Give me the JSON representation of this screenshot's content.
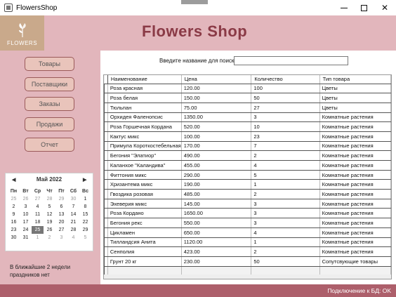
{
  "window": {
    "title": "FlowersShop"
  },
  "logo": {
    "text": "FLOWERS"
  },
  "header": {
    "title": "Flowers Shop"
  },
  "nav": [
    "Товары",
    "Поставщики",
    "Заказы",
    "Продажи",
    "Отчет"
  ],
  "calendar": {
    "month": "Май 2022",
    "weekdays": [
      "Пн",
      "Вт",
      "Ср",
      "Чт",
      "Пт",
      "Сб",
      "Вс"
    ],
    "days": [
      [
        "25",
        "26",
        "27",
        "28",
        "29",
        "30",
        "1"
      ],
      [
        "2",
        "3",
        "4",
        "5",
        "6",
        "7",
        "8"
      ],
      [
        "9",
        "10",
        "11",
        "12",
        "13",
        "14",
        "15"
      ],
      [
        "16",
        "17",
        "18",
        "19",
        "20",
        "21",
        "22"
      ],
      [
        "23",
        "24",
        "25",
        "26",
        "27",
        "28",
        "29"
      ],
      [
        "30",
        "31",
        "1",
        "2",
        "3",
        "4",
        "5"
      ]
    ],
    "today": "25"
  },
  "holiday_note": "В ближайшие 2 недели праздников нет",
  "search": {
    "label": "Введите название для поиска:",
    "value": "",
    "placeholder": ""
  },
  "table": {
    "columns": [
      "Наименование",
      "Цена",
      "Количество",
      "Тип товара"
    ],
    "rows": [
      [
        "Роза красная",
        "120.00",
        "100",
        "Цветы"
      ],
      [
        "Роза белая",
        "150.00",
        "50",
        "Цветы"
      ],
      [
        "Тюльпан",
        "75.00",
        "27",
        "Цветы"
      ],
      [
        "Орхидея Фаленопсис",
        "1350.00",
        "3",
        "Комнатные растения"
      ],
      [
        "Роза Горшечная Кордана",
        "520.00",
        "10",
        "Комнатные растения"
      ],
      [
        "Кактус микс",
        "100.00",
        "23",
        "Комнатные растения"
      ],
      [
        "Примула Короткостебельная",
        "170.00",
        "7",
        "Комнатные растения"
      ],
      [
        "Бегония \"Элатиор\"",
        "490.00",
        "2",
        "Комнатные растения"
      ],
      [
        "Каланхое \"Каландива\"",
        "455.00",
        "4",
        "Комнатные растения"
      ],
      [
        "Фиттония микс",
        "290.00",
        "5",
        "Комнатные растения"
      ],
      [
        "Хризантема микс",
        "190.00",
        "1",
        "Комнатные растения"
      ],
      [
        "Гвоздика розовая",
        "485.00",
        "2",
        "Комнатные растения"
      ],
      [
        "Эхеверия микс",
        "145.00",
        "3",
        "Комнатные растения"
      ],
      [
        "Роза Кордано",
        "1650.00",
        "3",
        "Комнатные растения"
      ],
      [
        "Бегония рекс",
        "550.00",
        "3",
        "Комнатные растения"
      ],
      [
        "Цикламен",
        "650.00",
        "4",
        "Комнатные растения"
      ],
      [
        "Тилландсия Анита",
        "1120.00",
        "1",
        "Комнатные растения"
      ],
      [
        "Сенполия",
        "423.00",
        "2",
        "Комнатные растения"
      ],
      [
        "Грунт 20 кг",
        "230.00",
        "50",
        "Сопутсвующие товары"
      ]
    ]
  },
  "status": {
    "text": "Подключение к БД: OK"
  },
  "colors": {
    "accent": "#e2b6bc",
    "title": "#8a3a46",
    "statusbar": "#ad5f6b"
  }
}
